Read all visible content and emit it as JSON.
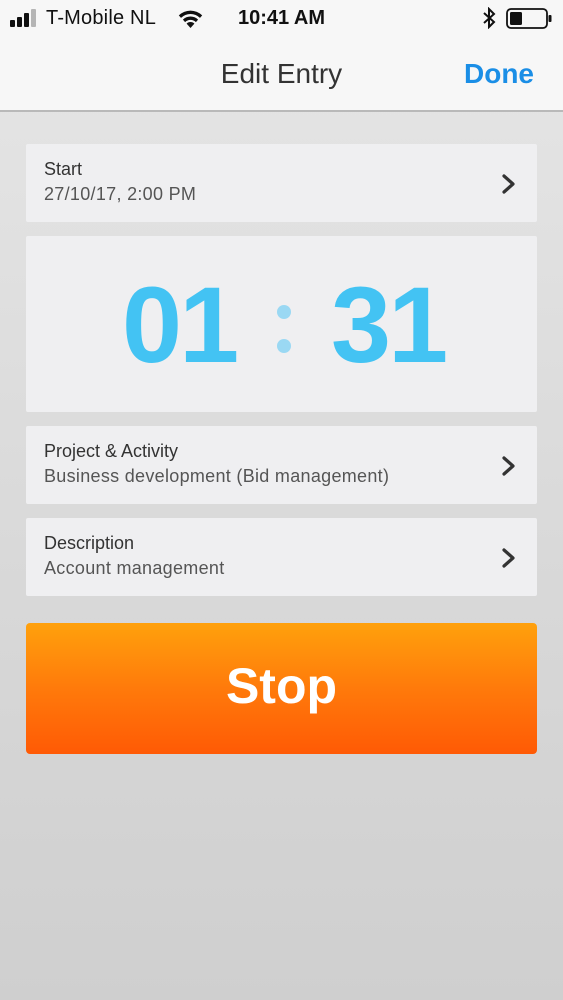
{
  "status_bar": {
    "carrier": "T-Mobile NL",
    "time": "10:41 AM",
    "icons": [
      "signal-icon",
      "wifi-icon",
      "bluetooth-icon",
      "battery-icon"
    ]
  },
  "nav": {
    "title": "Edit Entry",
    "done_label": "Done"
  },
  "start": {
    "label": "Start",
    "value": "27/10/17, 2:00 PM"
  },
  "timer": {
    "hours": "01",
    "minutes": "31"
  },
  "project": {
    "label": "Project & Activity",
    "value": "Business development (Bid management)"
  },
  "description": {
    "label": "Description",
    "value": "Account management"
  },
  "stop_button": {
    "label": "Stop"
  },
  "colors": {
    "accent": "#1a8ee6",
    "timer": "#43c3f3",
    "stop_top": "#ffa10c",
    "stop_bottom": "#ff5a05"
  }
}
